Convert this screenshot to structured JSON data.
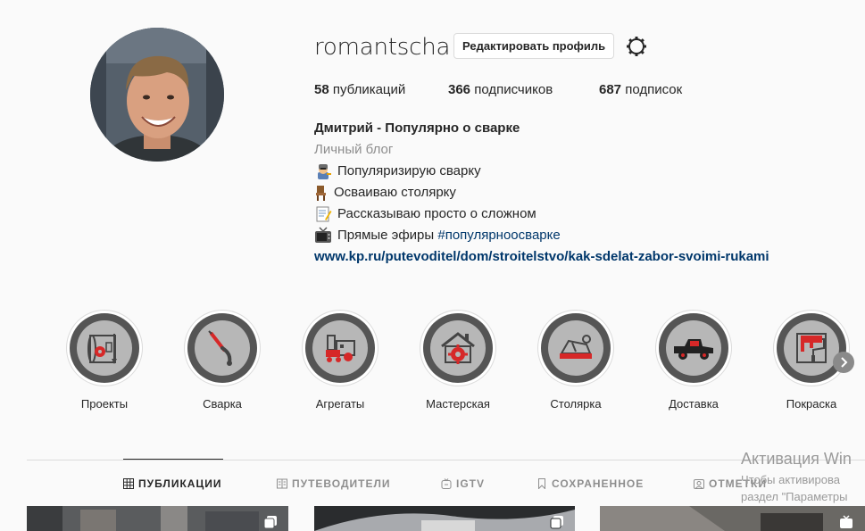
{
  "profile": {
    "username": "romantscha",
    "edit_label": "Редактировать профиль",
    "stats": [
      {
        "value": "58",
        "label": "публикаций"
      },
      {
        "value": "366",
        "label": "подписчиков"
      },
      {
        "value": "687",
        "label": "подписок"
      }
    ],
    "full_name": "Дмитрий - Популярно о сварке",
    "category": "Личный блог",
    "bio_lines": [
      {
        "emoji": "welder-icon",
        "text": "Популяризирую сварку"
      },
      {
        "emoji": "chair-icon",
        "text": "Осваиваю столярку"
      },
      {
        "emoji": "memo-icon",
        "text": "Рассказываю просто о сложном"
      },
      {
        "emoji": "tv-icon",
        "text": "Прямые эфиры ",
        "hashtag": "#популярноосварке"
      }
    ],
    "website": "www.kp.ru/putevoditel/dom/stroitelstvo/kak-sdelat-zabor-svoimi-rukami"
  },
  "highlights": [
    {
      "label": "Проекты",
      "icon": "blueprint-icon"
    },
    {
      "label": "Сварка",
      "icon": "welding-torch-icon"
    },
    {
      "label": "Агрегаты",
      "icon": "machine-icon"
    },
    {
      "label": "Мастерская",
      "icon": "workshop-gear-icon"
    },
    {
      "label": "Столярка",
      "icon": "wood-plane-icon"
    },
    {
      "label": "Доставка",
      "icon": "truck-icon"
    },
    {
      "label": "Покраска",
      "icon": "paint-roller-icon"
    }
  ],
  "tabs": [
    {
      "label": "ПУБЛИКАЦИИ",
      "icon": "grid-icon",
      "active": true
    },
    {
      "label": "ПУТЕВОДИТЕЛИ",
      "icon": "guide-icon",
      "active": false
    },
    {
      "label": "IGTV",
      "icon": "igtv-icon",
      "active": false
    },
    {
      "label": "СОХРАНЕННОЕ",
      "icon": "bookmark-icon",
      "active": false
    },
    {
      "label": "ОТМЕТКИ",
      "icon": "tagged-icon",
      "active": false
    }
  ],
  "watermark": {
    "line1": "Активация Win",
    "line2": "Чтобы активирова",
    "line3": "раздел \"Параметры"
  },
  "colors": {
    "accent": "#00376b",
    "highlight_red": "#d62828"
  }
}
